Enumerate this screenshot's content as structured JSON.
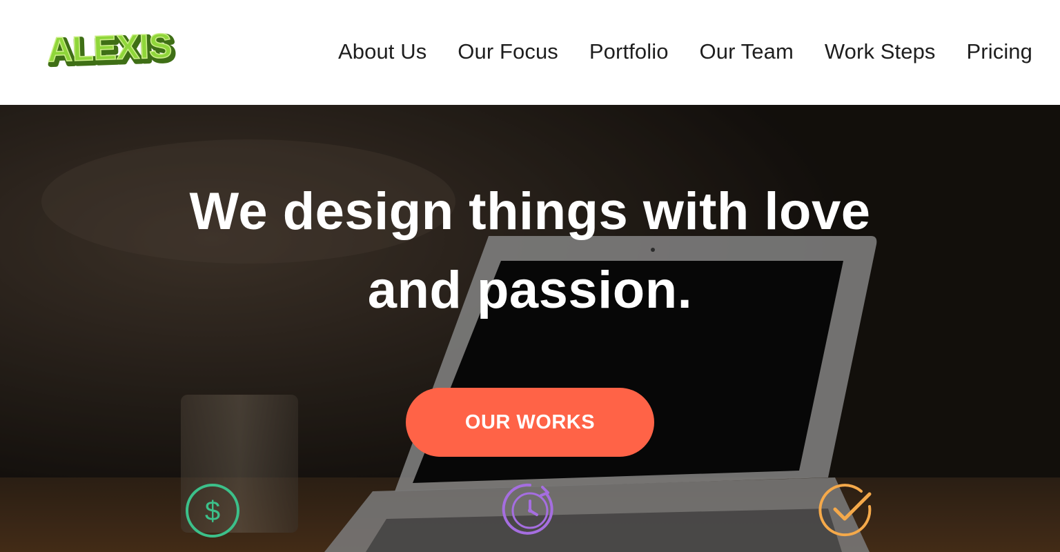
{
  "header": {
    "logo_text": "ALEXIS",
    "nav": [
      {
        "label": "About Us"
      },
      {
        "label": "Our Focus"
      },
      {
        "label": "Portfolio"
      },
      {
        "label": "Our Team"
      },
      {
        "label": "Work Steps"
      },
      {
        "label": "Pricing"
      }
    ]
  },
  "hero": {
    "headline_line1": "We design things with love",
    "headline_line2": "and passion.",
    "cta_label": "OUR WORKS"
  },
  "features": [
    {
      "icon": "dollar-icon",
      "color": "#3cc08a"
    },
    {
      "icon": "clock-icon",
      "color": "#a56ee0"
    },
    {
      "icon": "check-icon",
      "color": "#f5a94a"
    }
  ],
  "colors": {
    "accent": "#ff6347",
    "logo_green": "#8fd63a",
    "nav_text": "#1e1e1e"
  }
}
